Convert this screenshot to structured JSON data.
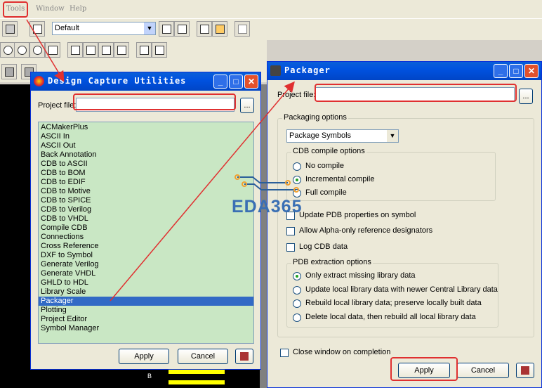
{
  "menu": {
    "tools": "Tools",
    "window": "Window",
    "help": "Help"
  },
  "toolbar": {
    "schematic_select": "Default"
  },
  "dcu": {
    "title": "Design Capture Utilities",
    "project_file_label": "Project file:",
    "project_file_value": "",
    "browse_label": "...",
    "items": [
      "ACMakerPlus",
      "ASCII In",
      "ASCII Out",
      "Back Annotation",
      "CDB to ASCII",
      "CDB to BOM",
      "CDB to EDIF",
      "CDB to Motive",
      "CDB to SPICE",
      "CDB to Verilog",
      "CDB to VHDL",
      "Compile CDB",
      "Connections",
      "Cross Reference",
      "DXF to Symbol",
      "Generate Verilog",
      "Generate VHDL",
      "GHLD to HDL",
      "Library Scale",
      "Packager",
      "Plotting",
      "Project Editor",
      "Symbol Manager"
    ],
    "selected": "Packager",
    "apply_label": "Apply",
    "cancel_label": "Cancel"
  },
  "packager": {
    "title": "Packager",
    "project_file_label": "Project file:",
    "project_file_value": "",
    "browse_label": "...",
    "packaging_options_label": "Packaging options",
    "packaging_select": "Package Symbols",
    "cdb_group_label": "CDB compile options",
    "cdb_options": [
      "No compile",
      "Incremental compile",
      "Full compile"
    ],
    "cdb_selected": "Incremental compile",
    "update_pdb_label": "Update PDB properties on symbol",
    "alpha_ref_label": "Allow Alpha-only reference designators",
    "log_cdb_label": "Log CDB data",
    "pdb_group_label": "PDB extraction options",
    "pdb_options": [
      "Only extract missing library data",
      "Update local library data with newer Central Library data",
      "Rebuild local library data; preserve locally built data",
      "Delete local data, then rebuild all local library data"
    ],
    "pdb_selected": "Only extract missing library data",
    "close_on_completion_label": "Close window on completion",
    "apply_label": "Apply",
    "cancel_label": "Cancel"
  },
  "watermark": "EDA365",
  "canvas_marker": "B",
  "colors": {
    "highlight": "#e03030",
    "title_blue": "#0052e0",
    "list_bg": "#c9e7c4",
    "selection": "#316ac5"
  }
}
